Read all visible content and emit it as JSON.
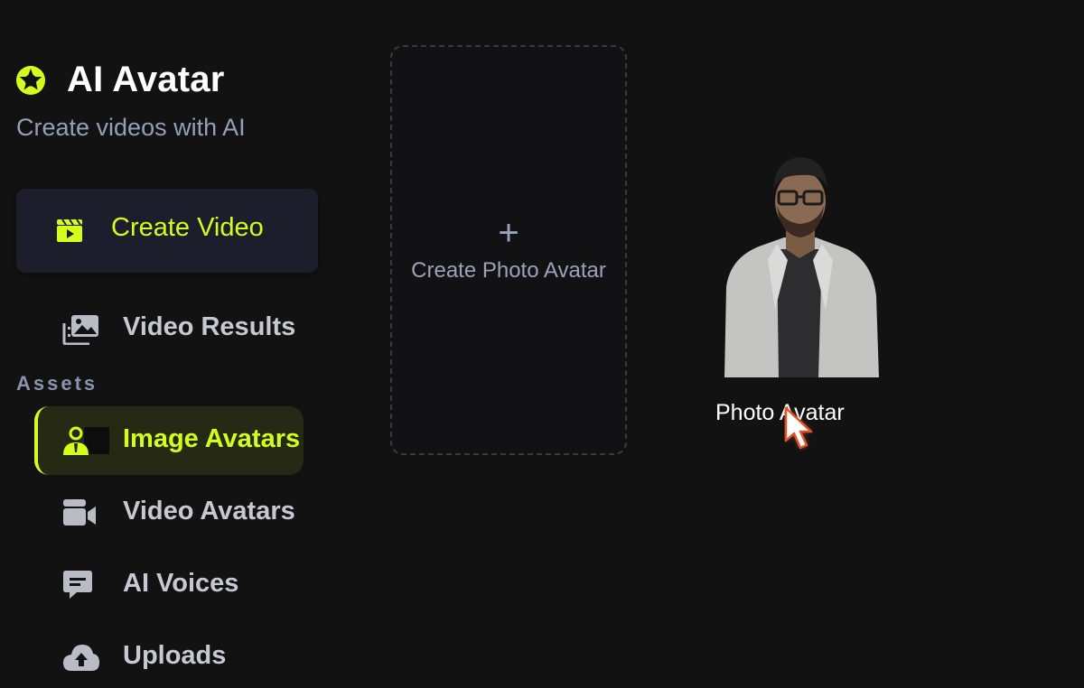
{
  "brand": {
    "title": "AI Avatar",
    "subtitle": "Create videos with AI",
    "icon": "aperture-icon",
    "accent": "#d4ff1c"
  },
  "sidebar": {
    "create_button": {
      "label": "Create Video",
      "icon": "clapperboard-icon"
    },
    "items": [
      {
        "label": "Video Results",
        "icon": "gallery-icon",
        "active": false
      }
    ],
    "section_label": "Assets",
    "asset_items": [
      {
        "label": "Image Avatars",
        "icon": "user-badge-icon",
        "active": true
      },
      {
        "label": "Video Avatars",
        "icon": "video-camera-icon",
        "active": false
      },
      {
        "label": "AI Voices",
        "icon": "chat-icon",
        "active": false
      },
      {
        "label": "Uploads",
        "icon": "cloud-upload-icon",
        "active": false
      }
    ]
  },
  "main": {
    "create_card": {
      "plus": "+",
      "label": "Create Photo Avatar"
    },
    "avatars": [
      {
        "name": "Photo Avatar"
      }
    ]
  },
  "colors": {
    "background": "#121212",
    "active_bg": "#262a14",
    "button_bg": "#1d1d2b",
    "muted_text": "#94a0b8",
    "nav_text": "#c6c9d1"
  }
}
